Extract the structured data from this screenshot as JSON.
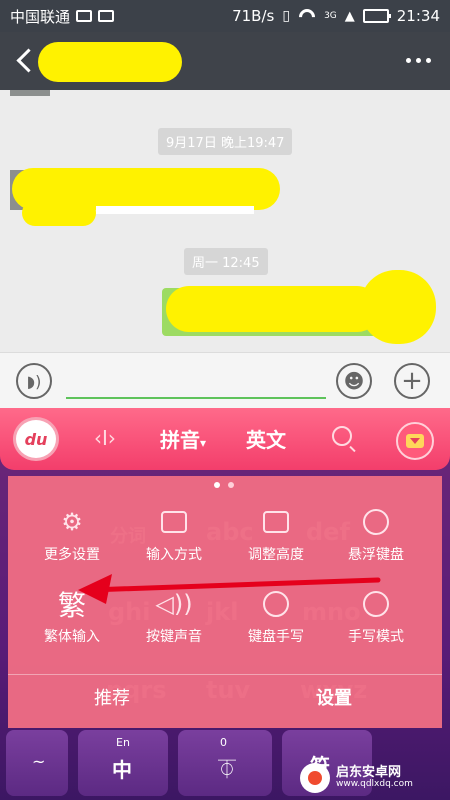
{
  "status_bar": {
    "carrier": "中国联通",
    "speed": "71B/s",
    "network": "3G",
    "time": "21:34"
  },
  "chat": {
    "timestamps": [
      "9月17日 晚上19:47",
      "周一 12:45"
    ]
  },
  "keyboard": {
    "logo": "du",
    "tabs": [
      {
        "label": "拼音",
        "active": true
      },
      {
        "label": "英文",
        "active": false
      }
    ],
    "ghost_keys": [
      "分词",
      "abc",
      "def",
      "ghi",
      "jkl",
      "mno",
      "pqrs",
      "tuv",
      "wxyz"
    ],
    "panel_items": [
      {
        "label": "更多设置",
        "icon": "gear-icon"
      },
      {
        "label": "输入方式",
        "icon": "keyboard-switch-icon"
      },
      {
        "label": "调整高度",
        "icon": "height-adjust-icon"
      },
      {
        "label": "悬浮键盘",
        "icon": "ufo-icon"
      },
      {
        "label": "繁体输入",
        "icon": "traditional-char-icon",
        "glyph": "繁"
      },
      {
        "label": "按键声音",
        "icon": "speaker-icon"
      },
      {
        "label": "键盘手写",
        "icon": "handwrite-keyboard-icon"
      },
      {
        "label": "手写模式",
        "icon": "handwrite-mode-icon"
      }
    ],
    "panel_tabs": [
      {
        "label": "推荐",
        "active": false
      },
      {
        "label": "设置",
        "active": true
      }
    ],
    "bottom_keys": {
      "tilde": "~",
      "lang_top": "En",
      "lang_main": "中",
      "space_top": "0",
      "symbol": "符"
    }
  },
  "watermark": {
    "title": "启东安卓网",
    "url": "www.qdlxdq.com"
  },
  "colors": {
    "status_bg": "#3c4149",
    "appbar_bg": "#3f434a",
    "toolbar_pink": "#f33e6b",
    "panel_pink": "#f57084",
    "keyboard_purple": "#5a1c78",
    "highlight_yellow": "#fff200",
    "bubble_green": "#9ddb62",
    "arrow_red": "#e5001c"
  }
}
